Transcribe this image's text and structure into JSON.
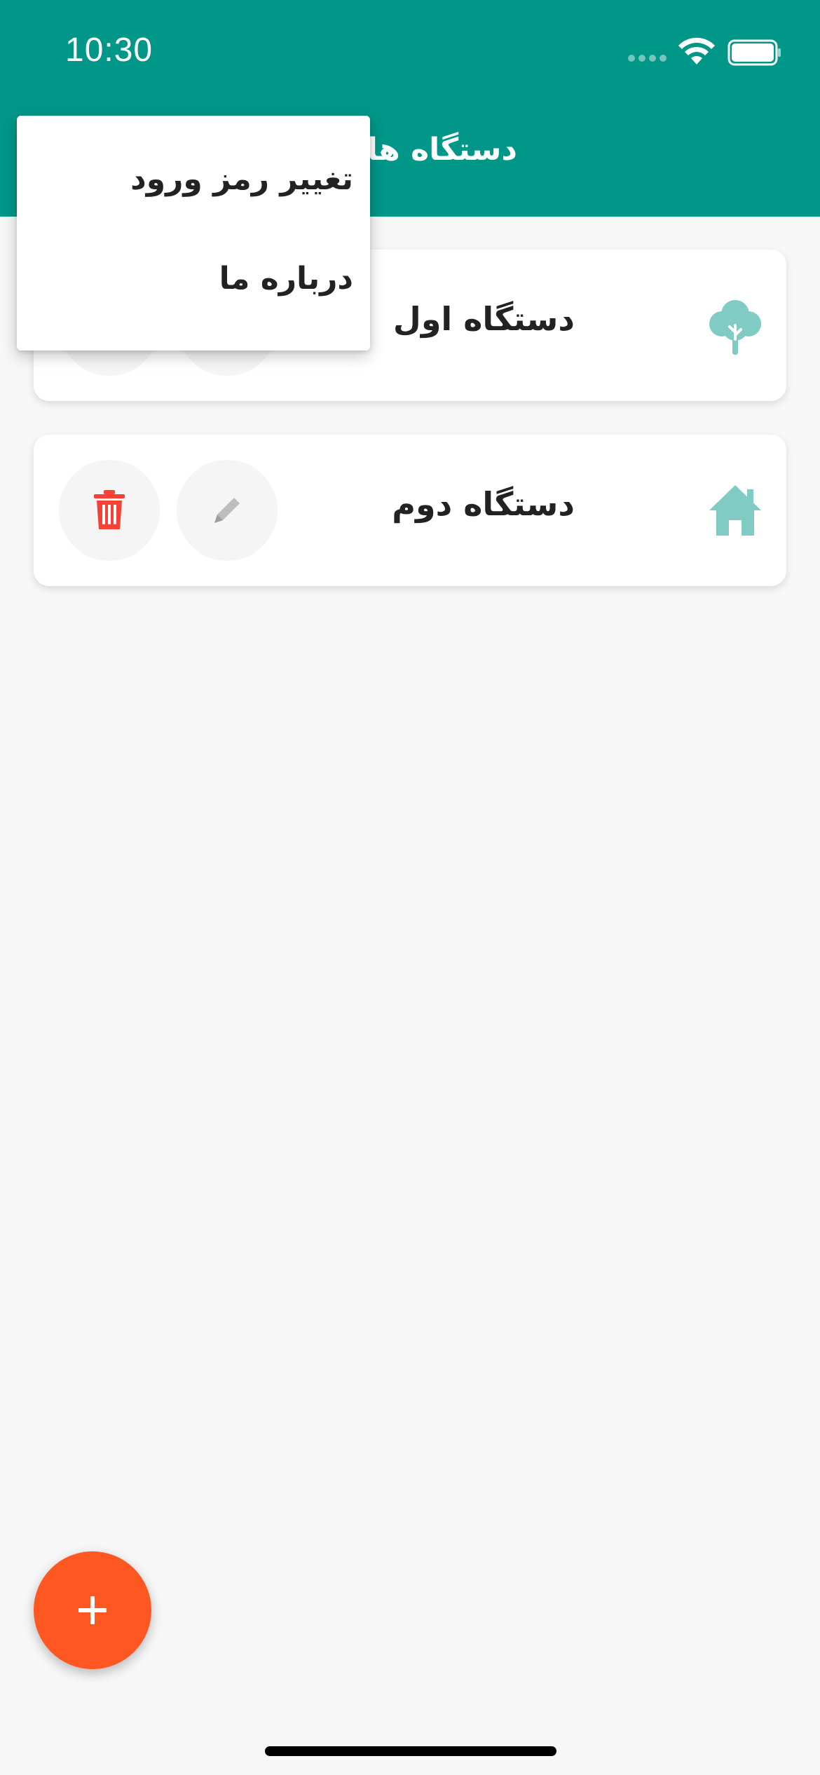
{
  "status_bar": {
    "time": "10:30"
  },
  "app_bar": {
    "title": "دستگاه های"
  },
  "devices": [
    {
      "name": "دستگاه اول",
      "icon": "tree-icon"
    },
    {
      "name": "دستگاه دوم",
      "icon": "home-icon"
    }
  ],
  "popup_menu": {
    "items": [
      {
        "label": "تغییر رمز ورود"
      },
      {
        "label": "درباره ما"
      }
    ]
  },
  "fab": {
    "icon": "plus-icon"
  },
  "colors": {
    "primary": "#009688",
    "accent": "#ff5722",
    "device_icon": "#80cbc4",
    "delete_icon": "#f44336",
    "edit_icon": "#bdbdbd",
    "background": "#f7f7f7"
  }
}
